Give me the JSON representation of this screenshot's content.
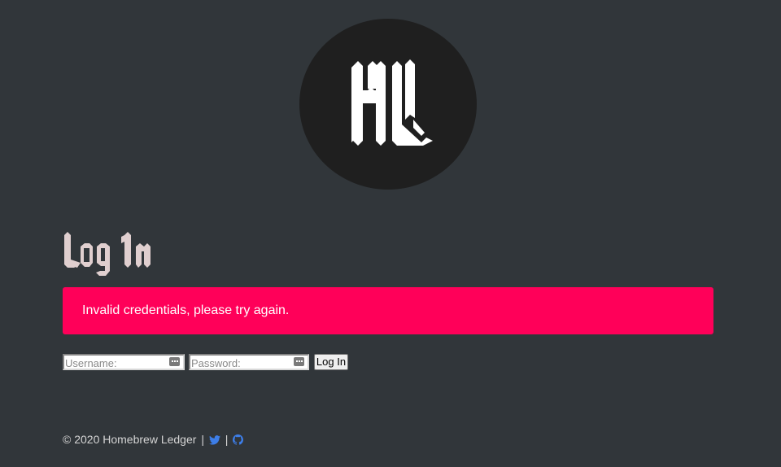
{
  "logo": {
    "alt": "Homebrew Ledger logo",
    "monogram": "HL"
  },
  "heading": {
    "text": "Log In"
  },
  "alert": {
    "message": "Invalid credentials, please try again.",
    "color": "#ff0059"
  },
  "form": {
    "username_placeholder": "Username:",
    "password_placeholder": "Password:",
    "submit_label": "Log In"
  },
  "footer": {
    "copyright": "© 2020 Homebrew Ledger",
    "separator": "|",
    "icons": [
      "twitter-icon",
      "github-icon"
    ],
    "icon_color": "#3d7ee8"
  },
  "colors": {
    "background": "#31363a",
    "logo_circle": "#1f1f1f",
    "heading": "#e0cfcf"
  }
}
